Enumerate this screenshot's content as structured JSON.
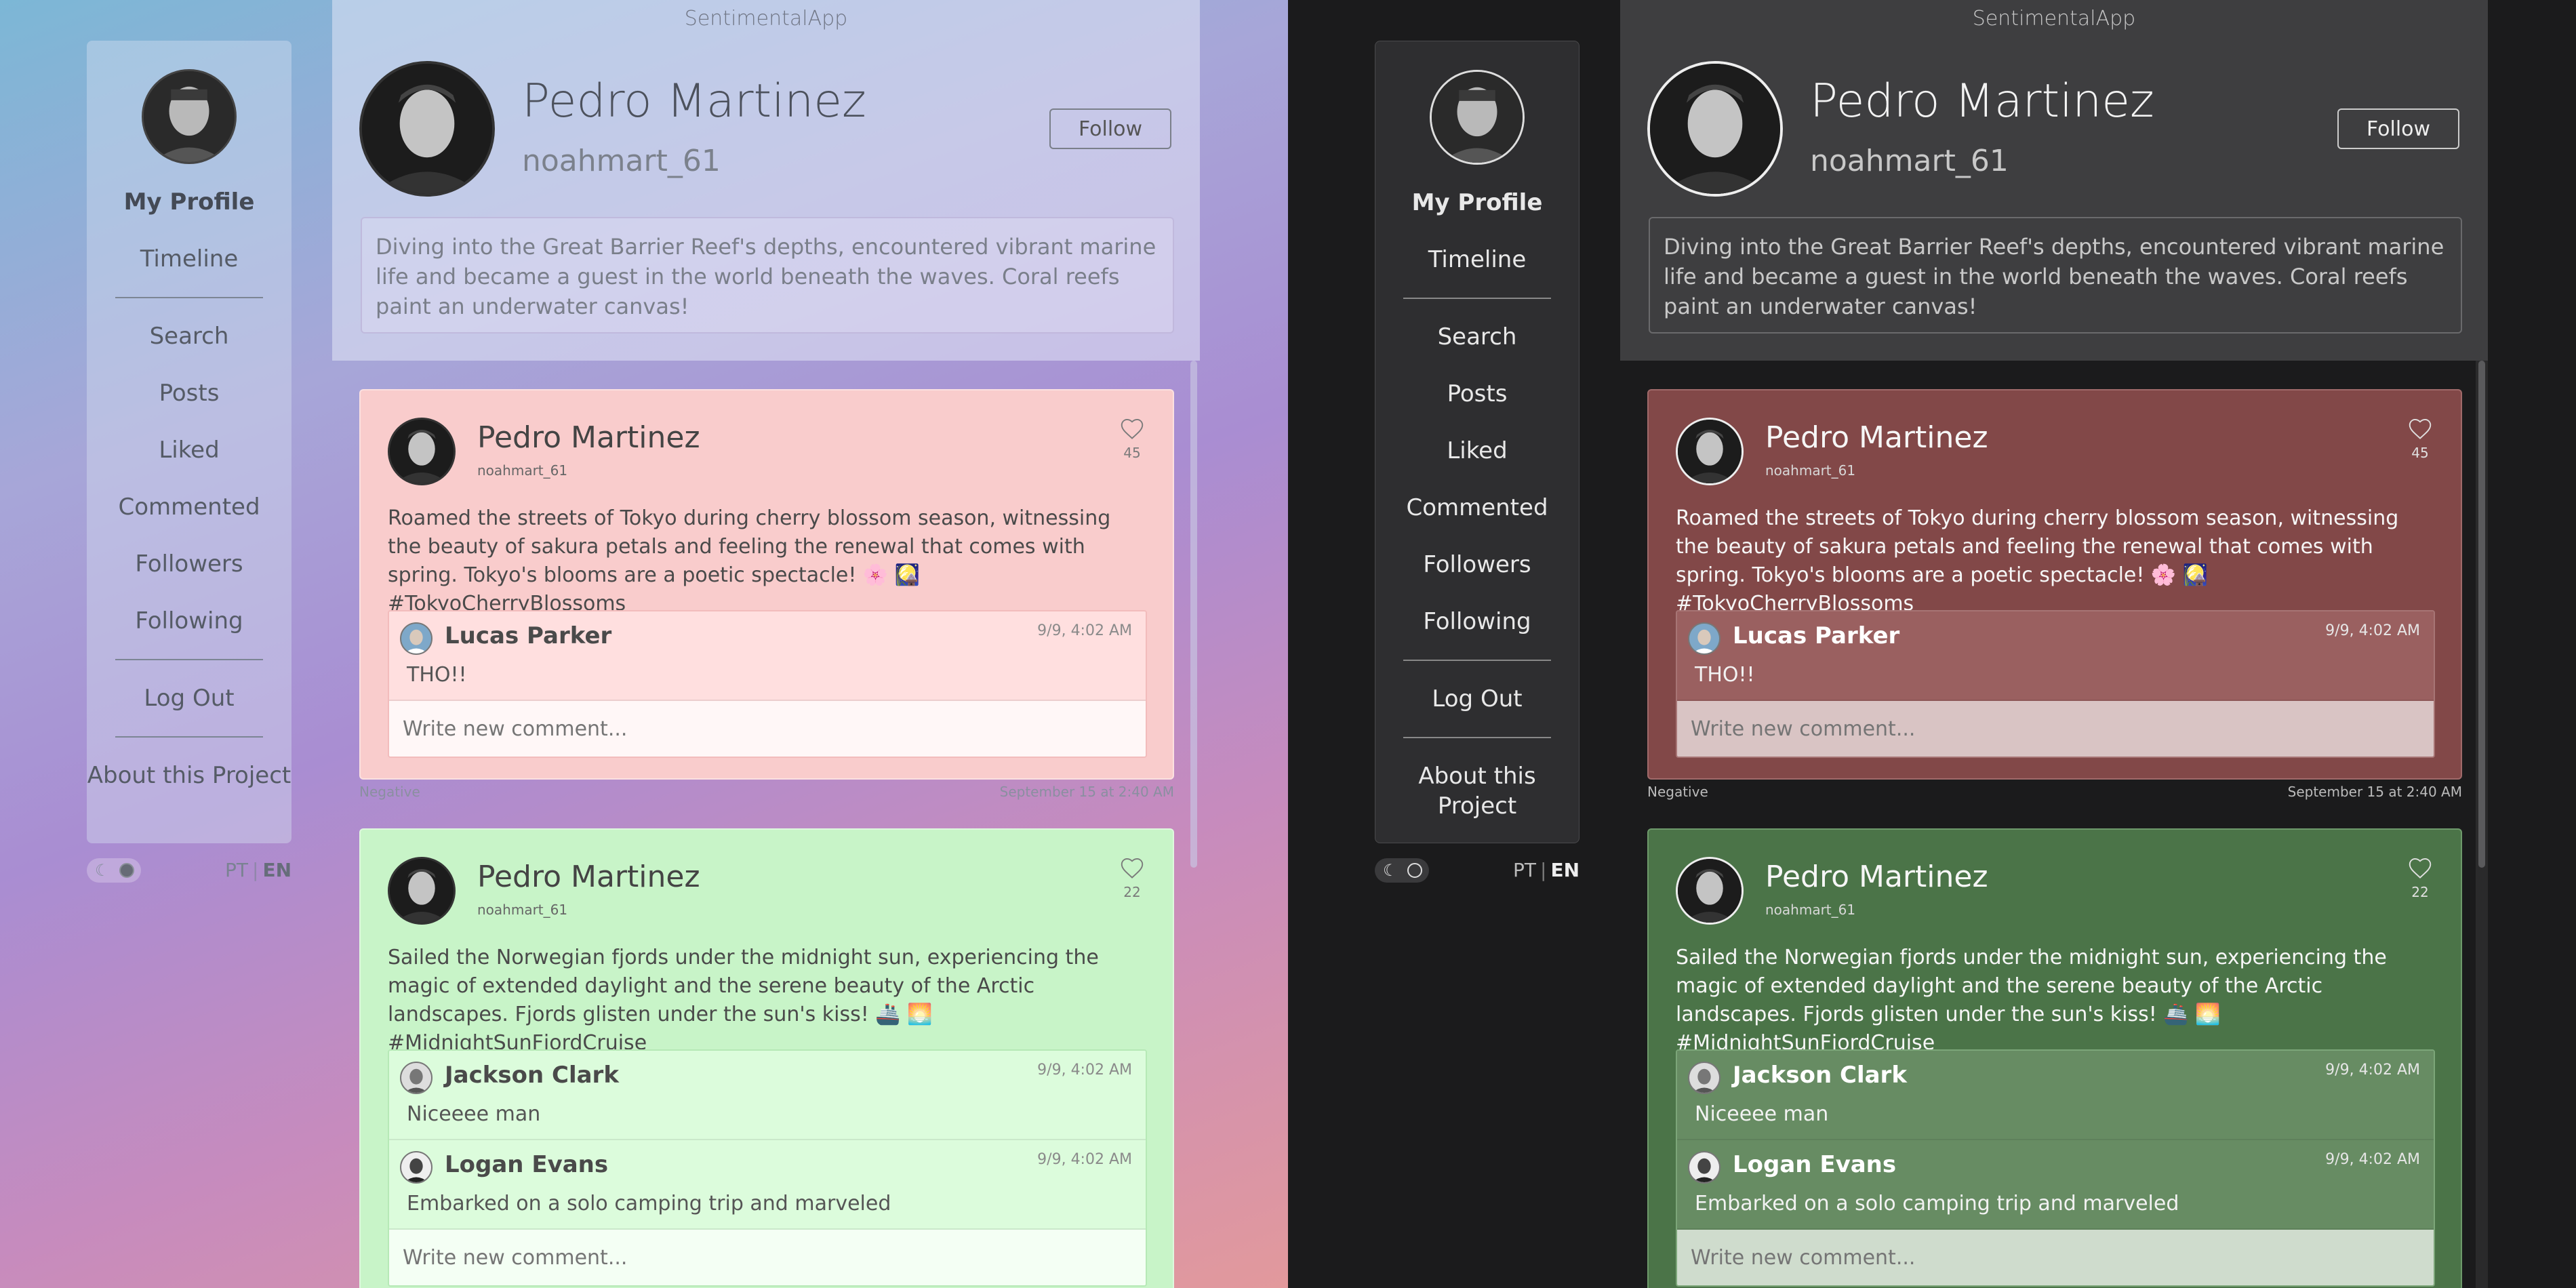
{
  "app": {
    "title": "SentimentalApp"
  },
  "sidebar": {
    "items": [
      {
        "label": "My Profile"
      },
      {
        "label": "Timeline"
      },
      {
        "label": "Search"
      },
      {
        "label": "Posts"
      },
      {
        "label": "Liked"
      },
      {
        "label": "Commented"
      },
      {
        "label": "Followers"
      },
      {
        "label": "Following"
      },
      {
        "label": "Log Out"
      },
      {
        "label": "About this Project"
      }
    ]
  },
  "language": {
    "pt": "PT",
    "en": "EN",
    "separator": "|"
  },
  "profile": {
    "name": "Pedro Martinez",
    "handle": "noahmart_61",
    "follow_label": "Follow",
    "bio": "Diving into the Great Barrier Reef's depths, encountered vibrant marine life and became a guest in the world beneath the waves. Coral reefs paint an underwater canvas!"
  },
  "posts": [
    {
      "author": "Pedro Martinez",
      "handle": "noahmart_61",
      "likes": "45",
      "text": "Roamed the streets of Tokyo during cherry blossom season, witnessing the beauty of sakura petals and feeling the renewal that comes with spring. Tokyo's blooms are a poetic spectacle! 🌸 🎑 #TokyoCherryBlossoms",
      "sentiment": "Negative",
      "timestamp": "September 15 at 2:40 AM",
      "comments": [
        {
          "author": "Lucas Parker",
          "date": "9/9, 4:02 AM",
          "text": "THO!!"
        }
      ],
      "comment_placeholder": "Write new comment..."
    },
    {
      "author": "Pedro Martinez",
      "handle": "noahmart_61",
      "likes": "22",
      "text": "Sailed the Norwegian fjords under the midnight sun, experiencing the magic of extended daylight and the serene beauty of the Arctic landscapes. Fjords glisten under the sun's kiss! 🚢 🌅 #MidnightSunFjordCruise",
      "comments": [
        {
          "author": "Jackson Clark",
          "date": "9/9, 4:02 AM",
          "text": "Niceeee man"
        },
        {
          "author": "Logan Evans",
          "date": "9/9, 4:02 AM",
          "text": "Embarked on a solo camping trip and marveled"
        }
      ],
      "comment_placeholder": "Write new comment..."
    }
  ],
  "colors": {
    "negative_light": "#f9cccc",
    "positive_light": "#c8f4c8",
    "negative_dark": "#824848",
    "positive_dark": "#4b7448",
    "dark_background": "#1b1b1c"
  },
  "icons": [
    "moon-icon",
    "heart-icon",
    "avatar"
  ]
}
